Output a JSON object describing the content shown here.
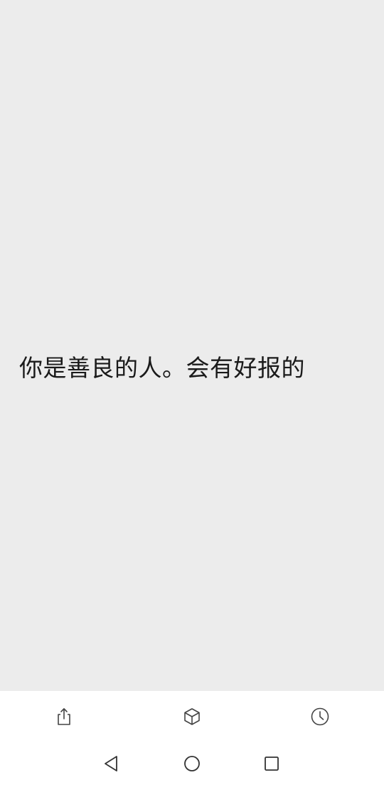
{
  "main": {
    "quote_text": "你是善良的人。会有好报的"
  },
  "toolbar": {
    "buttons": [
      {
        "icon": "share-icon"
      },
      {
        "icon": "cube-icon"
      },
      {
        "icon": "clock-icon"
      }
    ]
  },
  "navbar": {
    "buttons": [
      {
        "icon": "back-triangle-icon"
      },
      {
        "icon": "home-circle-icon"
      },
      {
        "icon": "recents-square-icon"
      }
    ]
  },
  "colors": {
    "background": "#ececec",
    "bar_background": "#ffffff",
    "text": "#1a1a1a",
    "icon": "#444444"
  }
}
